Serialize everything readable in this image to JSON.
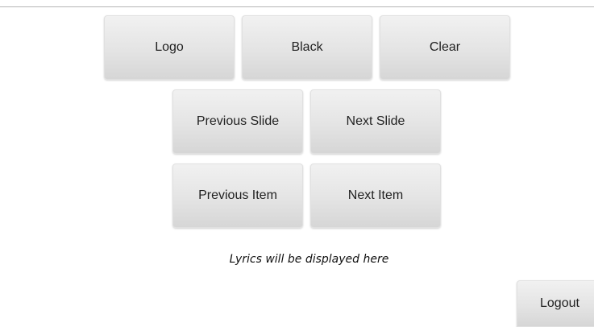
{
  "controls": {
    "row1": {
      "logo_label": "Logo",
      "black_label": "Black",
      "clear_label": "Clear"
    },
    "row2": {
      "previous_slide_label": "Previous Slide",
      "next_slide_label": "Next Slide"
    },
    "row3": {
      "previous_item_label": "Previous Item",
      "next_item_label": "Next Item"
    }
  },
  "lyrics": {
    "placeholder_text": "Lyrics will be displayed here"
  },
  "footer": {
    "logout_label": "Logout"
  }
}
